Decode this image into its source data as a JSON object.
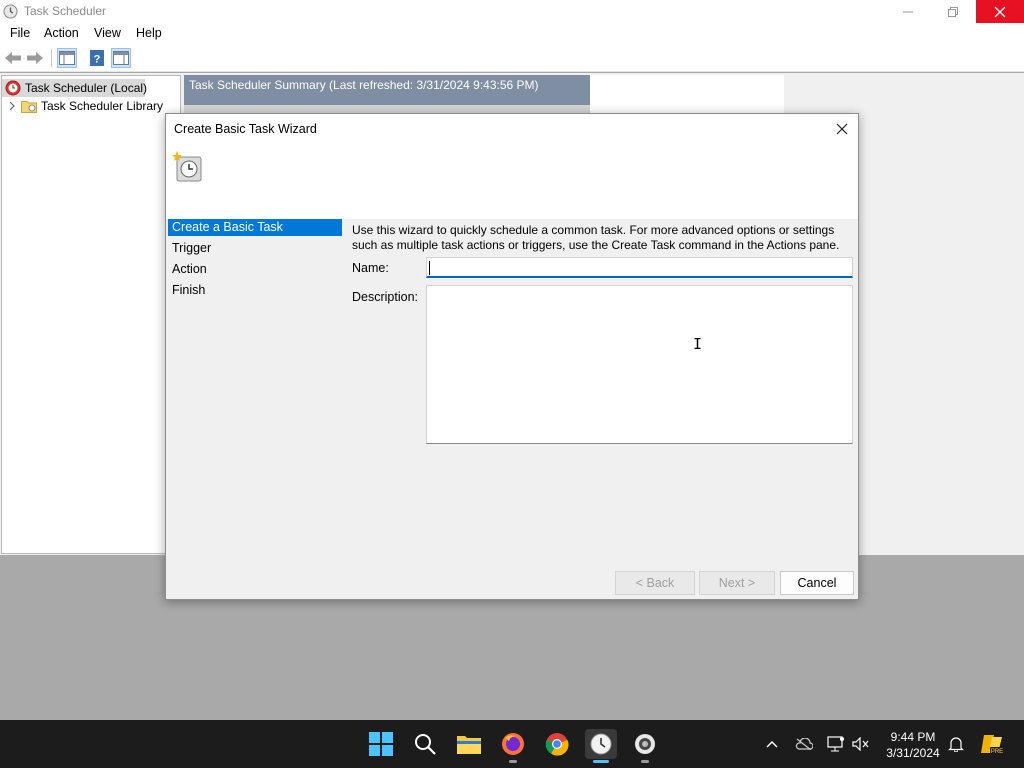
{
  "app": {
    "title": "Task Scheduler",
    "menu": [
      "File",
      "Action",
      "View",
      "Help"
    ]
  },
  "tree": {
    "root": "Task Scheduler (Local)",
    "library": "Task Scheduler Library"
  },
  "summary": {
    "title": "Task Scheduler Summary (Last refreshed: 3/31/2024 9:43:56 PM)"
  },
  "wizard": {
    "title": "Create Basic Task Wizard",
    "steps": [
      "Create a Basic Task",
      "Trigger",
      "Action",
      "Finish"
    ],
    "active_step": "Create a Basic Task",
    "intro": "Use this wizard to quickly schedule a common task.  For more advanced options or settings such as multiple task actions or triggers, use the Create Task command in the Actions pane.",
    "name_label": "Name:",
    "name_value": "",
    "description_label": "Description:",
    "description_value": "",
    "back_label": "< Back",
    "next_label": "Next >",
    "cancel_label": "Cancel"
  },
  "taskbar": {
    "apps": [
      "start-icon",
      "search-icon",
      "file-explorer-icon",
      "firefox-icon",
      "chrome-icon",
      "task-scheduler-icon",
      "app-icon"
    ],
    "time": "9:44 PM",
    "date": "3/31/2024"
  },
  "colors": {
    "accent": "#0078d7",
    "close_red": "#e81123",
    "taskbar": "#1c1c1c"
  }
}
